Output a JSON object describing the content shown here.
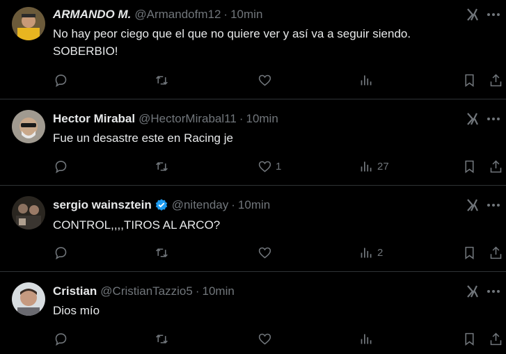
{
  "tweets": [
    {
      "name": "ARMANDO M.",
      "handle": "@Armandofm12",
      "sep": "·",
      "time": "10min",
      "text_lines": [
        "No hay peor ciego que el que no quiere ver y así va a seguir siendo.",
        "SOBERBIO!"
      ],
      "likes": "",
      "views": ""
    },
    {
      "name": "Hector Mirabal",
      "handle": "@HectorMirabal11",
      "sep": "·",
      "time": "10min",
      "text_lines": [
        "Fue un desastre este en Racing je"
      ],
      "likes": "1",
      "views": "27"
    },
    {
      "name": "sergio wainsztein",
      "handle": "@nitenday",
      "sep": "·",
      "time": "10min",
      "text_lines": [
        "CONTROL,,,,TIROS AL ARCO?"
      ],
      "likes": "",
      "views": "2"
    },
    {
      "name": "Cristian",
      "handle": "@CristianTazzio5",
      "sep": "·",
      "time": "10min",
      "text_lines": [
        "Dios mío"
      ],
      "likes": "",
      "views": ""
    }
  ],
  "colors": {
    "verified": "#1d9bf0",
    "muted": "#71767b",
    "text": "#e7e9ea",
    "border": "#2f3336"
  }
}
